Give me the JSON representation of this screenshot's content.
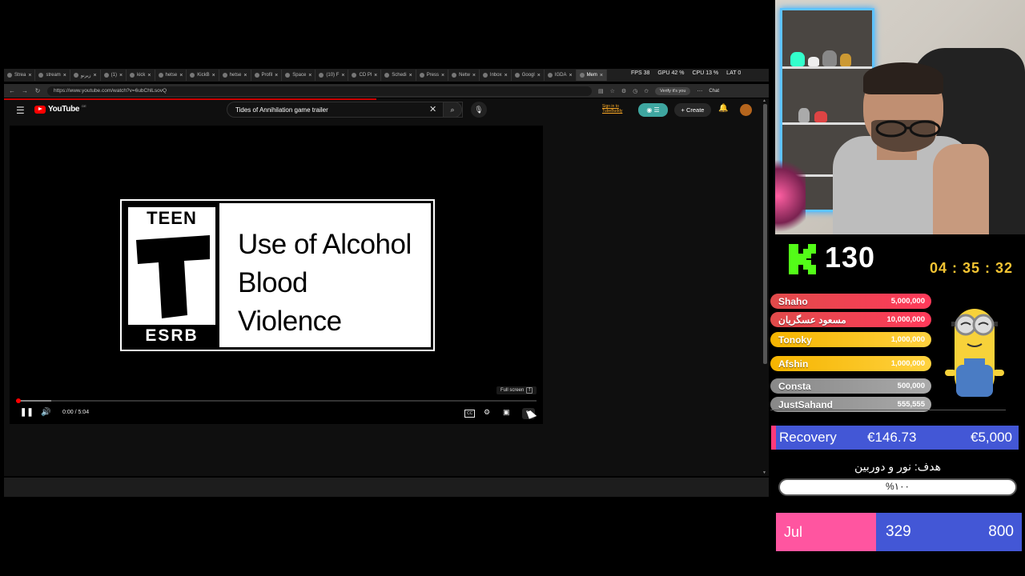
{
  "browser": {
    "tabs": [
      {
        "label": "Strea"
      },
      {
        "label": "stream"
      },
      {
        "label": "زیرنو"
      },
      {
        "label": "(1)"
      },
      {
        "label": "kick"
      },
      {
        "label": "hetse"
      },
      {
        "label": "KickB"
      },
      {
        "label": "hetse"
      },
      {
        "label": "Profil"
      },
      {
        "label": "Space"
      },
      {
        "label": "(10) F"
      },
      {
        "label": "CD Pl"
      },
      {
        "label": "Schedi"
      },
      {
        "label": "Press"
      },
      {
        "label": "Netw"
      },
      {
        "label": "Inbox"
      },
      {
        "label": "Googl"
      },
      {
        "label": "IGDA"
      },
      {
        "label": "Mem"
      }
    ],
    "perf_overlay": {
      "fps": "FPS",
      "fps_val": "38",
      "gpu": "GPU",
      "gpu_val": "42 %",
      "cpu": "CPU",
      "cpu_val": "13 %",
      "lat": "LAT",
      "lat_val": "0"
    },
    "url": "https://www.youtube.com/watch?v=6ubChlLsovQ",
    "verify_label": "Verify it's you",
    "chat_label": "Chat"
  },
  "youtube": {
    "logo_text": "YouTube",
    "logo_country": "DE",
    "search_value": "Tides of Annihilation  game trailer",
    "signin_line1": "Sign in to",
    "signin_line2": "TubeBuddy",
    "create_label": "Create"
  },
  "player": {
    "rating_top": "TEEN",
    "rating_letter": "T",
    "rating_bottom": "ESRB",
    "descriptors": [
      "Use of Alcohol",
      "Blood",
      "Violence"
    ],
    "fullscreen_tip": "Full screen",
    "fullscreen_key": "f",
    "time": "0:00 / 5:04",
    "progress": 0.004
  },
  "overlay": {
    "viewer_count": "130",
    "timer": "04 : 35 : 32",
    "donors": [
      {
        "name": "Shaho",
        "amount": "5,000,000",
        "tier": "red"
      },
      {
        "name": "مسعود عسگریان",
        "amount": "10,000,000",
        "tier": "red"
      },
      {
        "name": "Tonoky",
        "amount": "1,000,000",
        "tier": "gold"
      },
      {
        "name": "Afshin",
        "amount": "1,000,000",
        "tier": "gold"
      },
      {
        "name": "Consta",
        "amount": "500,000",
        "tier": "gray"
      },
      {
        "name": "JustSahand",
        "amount": "555,555",
        "tier": "gray"
      }
    ],
    "recovery": {
      "label": "Recovery",
      "current": "€146.73",
      "target": "€5,000"
    },
    "goal": {
      "title": "هدف: نور و دوربین",
      "percent_text": "%۱۰۰",
      "fraction": 1.0
    },
    "month": {
      "label": "Jul",
      "current": "329",
      "target": "800"
    }
  },
  "colors": {
    "kick_green": "#53fc18",
    "timer_gold": "#f2c433",
    "bar_blue": "#4357d6",
    "bar_pink": "#ff55a0",
    "donor_red": "#ff3a5a",
    "donor_gold": "#ffd23f",
    "youtube_red": "#ff0000"
  }
}
